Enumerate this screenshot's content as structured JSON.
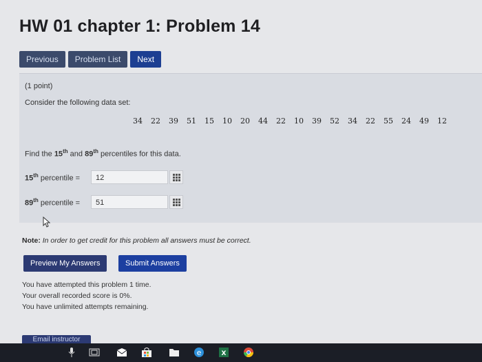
{
  "page": {
    "title": "HW 01 chapter 1: Problem 14"
  },
  "nav": {
    "previous": "Previous",
    "problem_list": "Problem List",
    "next": "Next"
  },
  "problem": {
    "points": "(1 point)",
    "prompt": "Consider the following data set:",
    "data_set": [
      "34",
      "22",
      "39",
      "51",
      "15",
      "10",
      "20",
      "44",
      "22",
      "10",
      "39",
      "52",
      "34",
      "22",
      "55",
      "24",
      "49",
      "12"
    ],
    "find_pre": "Find the ",
    "find_p1": "15",
    "find_p1_sup": "th",
    "find_mid": " and ",
    "find_p2": "89",
    "find_p2_sup": "th",
    "find_post": " percentiles for this data.",
    "answers": [
      {
        "num": "15",
        "sup": "th",
        "label": " percentile = ",
        "value": "12"
      },
      {
        "num": "89",
        "sup": "th",
        "label": " percentile = ",
        "value": "51"
      }
    ]
  },
  "note": {
    "label": "Note:",
    "text": " In order to get credit for this problem all answers must be correct."
  },
  "actions": {
    "preview": "Preview My Answers",
    "submit": "Submit Answers"
  },
  "status": [
    "You have attempted this problem 1 time.",
    "Your overall recorded score is 0%.",
    "You have unlimited attempts remaining."
  ],
  "email": {
    "label": "Email instructor"
  },
  "taskbar": {
    "icons": [
      "mic-icon",
      "task-view-icon",
      "mail-icon",
      "store-icon",
      "files-icon",
      "edge-icon",
      "excel-icon",
      "chrome-icon"
    ]
  }
}
